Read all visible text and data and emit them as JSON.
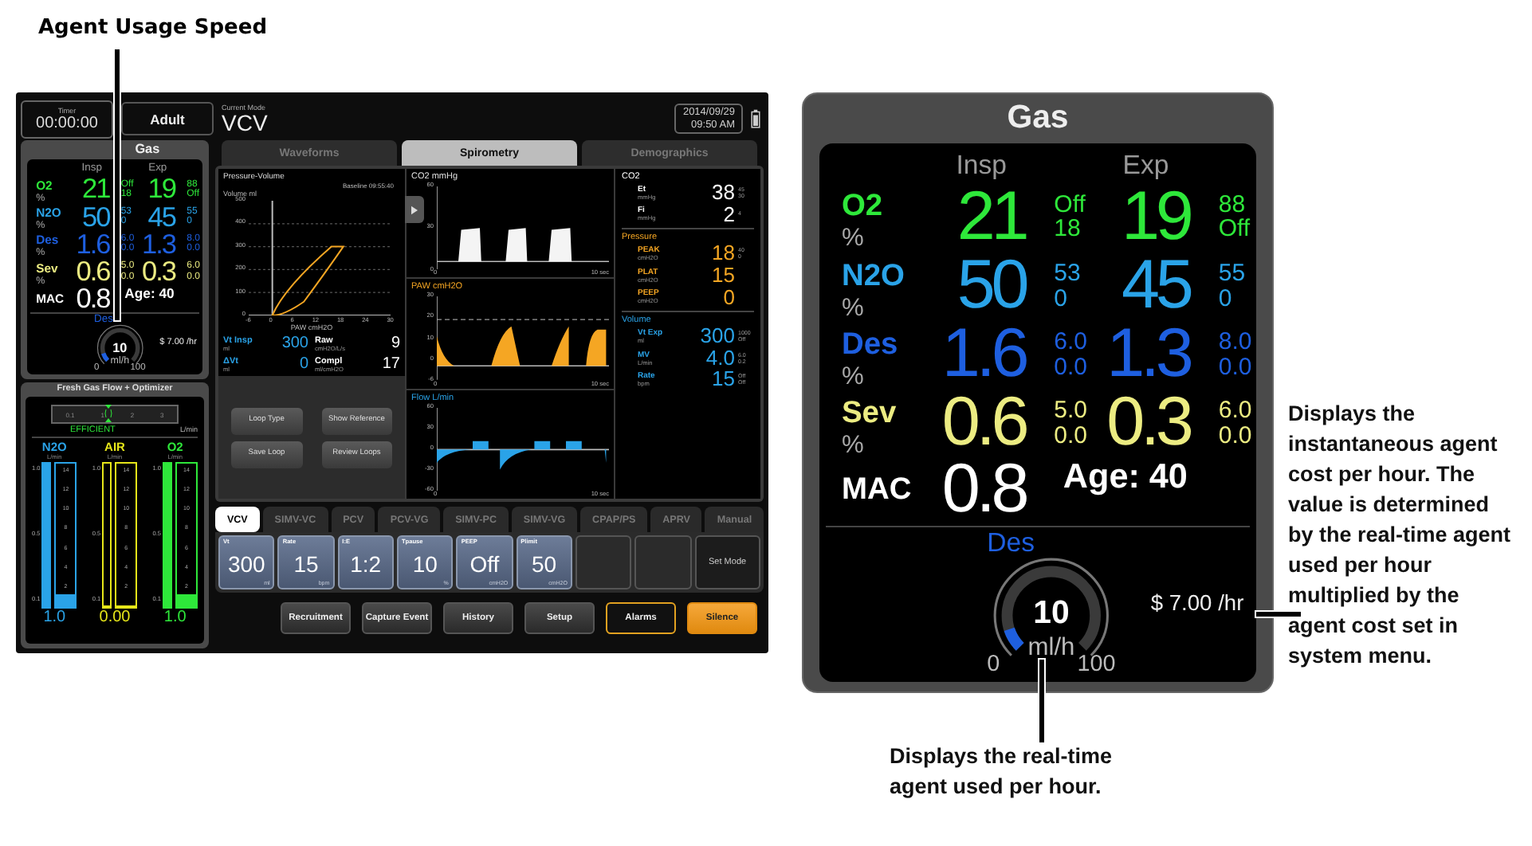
{
  "callouts": {
    "title": "Agent Usage Speed",
    "usage_note": "Displays the real-time agent used per hour.",
    "cost_note": "Displays the instantaneous agent cost per hour. The value is determined by the real-time agent used per hour multiplied by the agent cost set in system menu."
  },
  "screen": {
    "timer": {
      "label": "Timer",
      "value": "00:00:00"
    },
    "patient_type": "Adult",
    "mode": {
      "label": "Current Mode",
      "value": "VCV"
    },
    "date": "2014/09/29",
    "time": "09:50 AM",
    "gas": {
      "title": "Gas",
      "columns": [
        "Insp",
        "Exp"
      ],
      "agents": [
        {
          "name": "O2",
          "unit": "%",
          "color": "#2ee83a",
          "insp": "21",
          "insp_limits": [
            "Off",
            "18"
          ],
          "exp": "19",
          "exp_limits": [
            "88",
            "Off"
          ]
        },
        {
          "name": "N2O",
          "unit": "%",
          "color": "#2aa3e8",
          "insp": "50",
          "insp_limits": [
            "53",
            "0"
          ],
          "exp": "45",
          "exp_limits": [
            "55",
            "0"
          ]
        },
        {
          "name": "Des",
          "unit": "%",
          "color": "#1e5fe0",
          "insp": "1.6",
          "insp_limits": [
            "6.0",
            "0.0"
          ],
          "exp": "1.3",
          "exp_limits": [
            "8.0",
            "0.0"
          ]
        },
        {
          "name": "Sev",
          "unit": "%",
          "color": "#ecec82",
          "insp": "0.6",
          "insp_limits": [
            "5.0",
            "0.0"
          ],
          "exp": "0.3",
          "exp_limits": [
            "6.0",
            "0.0"
          ]
        }
      ],
      "mac": {
        "label": "MAC",
        "value": "0.8",
        "age": "Age: 40"
      },
      "usage": {
        "agent": "Des",
        "value": "10",
        "unit": "ml/h",
        "min": "0",
        "max": "100",
        "level": 0.1,
        "cost": "$ 7.00 /hr"
      }
    },
    "fresh_gas": {
      "title": "Fresh Gas Flow + Optimizer",
      "scale": [
        "0.1",
        "1",
        "2",
        "3"
      ],
      "level": 0.45,
      "status": "EFFICIENT",
      "unit": "L/min",
      "meters": [
        {
          "name": "N2O",
          "unit": "L/min",
          "color": "#2aa3e8",
          "fine_ticks": [
            "1.0",
            "0.5",
            "0.1"
          ],
          "coarse_ticks": [
            "14",
            "12",
            "10",
            "8",
            "6",
            "4",
            "2"
          ],
          "fine": {
            "level": 1
          },
          "coarse": {
            "level": 0.08
          },
          "value": "1.0"
        },
        {
          "name": "AIR",
          "unit": "L/min",
          "color": "#e6e619",
          "fine_ticks": [
            "1.0",
            "0.5",
            "0.1"
          ],
          "coarse_ticks": [
            "14",
            "12",
            "10",
            "8",
            "6",
            "4",
            "2"
          ],
          "fine": {
            "level": 0
          },
          "coarse": {
            "level": 0
          },
          "value": "0.00"
        },
        {
          "name": "O2",
          "unit": "L/min",
          "color": "#2ee83a",
          "fine_ticks": [
            "1.0",
            "0.5",
            "0.1"
          ],
          "coarse_ticks": [
            "14",
            "12",
            "10",
            "8",
            "6",
            "4",
            "2"
          ],
          "fine": {
            "level": 1
          },
          "coarse": {
            "level": 0.08
          },
          "value": "1.0"
        }
      ]
    },
    "tabs": [
      {
        "label": "Waveforms",
        "selected": false
      },
      {
        "label": "Spirometry",
        "selected": true
      },
      {
        "label": "Demographics",
        "selected": false
      }
    ],
    "loop": {
      "title": "Pressure-Volume",
      "baseline": "Baseline 09:55:40",
      "ylabel": "Volume ml",
      "yticks": [
        "500",
        "400",
        "300",
        "200",
        "100",
        "0"
      ],
      "xticks": [
        "-6",
        "0",
        "6",
        "12",
        "18",
        "24",
        "30"
      ],
      "xlabel": "PAW cmH2O"
    },
    "loop_values": [
      {
        "label": "Vt Insp",
        "unit": "ml",
        "value": "300",
        "color": "#2aa3e8"
      },
      {
        "label": "Raw",
        "unit": "cmH2O/L/s",
        "value": "9",
        "color": "#ffffff"
      },
      {
        "label": "ΔVt",
        "unit": "ml",
        "value": "0",
        "color": "#2aa3e8"
      },
      {
        "label": "Compl",
        "unit": "ml/cmH2O",
        "value": "17",
        "color": "#ffffff"
      }
    ],
    "loop_buttons": [
      "Loop Type",
      "Show Reference",
      "Save Loop",
      "Review Loops"
    ],
    "waveforms": [
      {
        "kind": "co2",
        "title": "CO2 mmHg",
        "yticks": [
          "60",
          "30",
          "0"
        ],
        "xticks": [
          "0",
          "10 sec"
        ]
      },
      {
        "kind": "paw",
        "title": "PAW cmH2O",
        "yticks": [
          "30",
          "20",
          "10",
          "0",
          "-6"
        ],
        "xticks": [
          "0",
          "10 sec"
        ]
      },
      {
        "kind": "flow",
        "title": "Flow L/min",
        "yticks": [
          "60",
          "30",
          "0",
          "-30",
          "-60"
        ],
        "xticks": [
          "0",
          "10 sec"
        ]
      }
    ],
    "numerics": [
      {
        "title": "CO2",
        "color": "#ffffff",
        "items": [
          {
            "label": "Et",
            "unit": "mmHg",
            "value": "38",
            "limits": [
              "45",
              "30"
            ]
          },
          {
            "label": "Fi",
            "unit": "mmHg",
            "value": "2",
            "limits": [
              "4"
            ]
          }
        ]
      },
      {
        "title": "Pressure",
        "color": "#f5a623",
        "items": [
          {
            "label": "PEAK",
            "unit": "cmH2O",
            "value": "18",
            "limits": [
              "40",
              "0"
            ]
          },
          {
            "label": "PLAT",
            "unit": "cmH2O",
            "value": "15"
          },
          {
            "label": "PEEP",
            "unit": "cmH2O",
            "value": "0"
          }
        ]
      },
      {
        "title": "Volume",
        "color": "#2aa3e8",
        "items": [
          {
            "label": "Vt Exp",
            "unit": "ml",
            "value": "300",
            "limits": [
              "1000",
              "Off"
            ]
          },
          {
            "label": "MV",
            "unit": "L/min",
            "value": "4.0",
            "limits": [
              "6.0",
              "0.2"
            ]
          },
          {
            "label": "Rate",
            "unit": "bpm",
            "value": "15",
            "limits": [
              "Off",
              "Off"
            ]
          }
        ]
      }
    ],
    "modes": [
      {
        "label": "VCV",
        "selected": true
      },
      {
        "label": "SIMV-VC",
        "selected": false
      },
      {
        "label": "PCV",
        "selected": false
      },
      {
        "label": "PCV-VG",
        "selected": false
      },
      {
        "label": "SIMV-PC",
        "selected": false
      },
      {
        "label": "SIMV-VG",
        "selected": false
      },
      {
        "label": "CPAP/PS",
        "selected": false
      },
      {
        "label": "APRV",
        "selected": false
      },
      {
        "label": "Manual",
        "selected": false
      }
    ],
    "settings": [
      {
        "kind": "setting",
        "label": "Vt",
        "value": "300",
        "unit": "ml"
      },
      {
        "kind": "setting",
        "label": "Rate",
        "value": "15",
        "unit": "bpm"
      },
      {
        "kind": "setting",
        "label": "I:E",
        "value": "1:2"
      },
      {
        "kind": "setting",
        "label": "Tpause",
        "value": "10",
        "unit": "%"
      },
      {
        "kind": "setting",
        "label": "PEEP",
        "value": "Off",
        "unit": "cmH2O"
      },
      {
        "kind": "setting",
        "label": "Plimit",
        "value": "50",
        "unit": "cmH2O"
      },
      {
        "kind": "empty"
      },
      {
        "kind": "empty"
      },
      {
        "kind": "button",
        "label": "Set Mode"
      }
    ],
    "actions": [
      {
        "label": "Recruitment",
        "kind": "normal"
      },
      {
        "label": "Capture Event",
        "kind": "normal"
      },
      {
        "label": "History",
        "kind": "normal"
      },
      {
        "label": "Setup",
        "kind": "normal"
      },
      {
        "label": "Alarms",
        "kind": "outlined"
      },
      {
        "label": "Silence",
        "kind": "alert"
      }
    ]
  },
  "gas_detail": {
    "title": "Gas",
    "columns": [
      "Insp",
      "Exp"
    ],
    "agents": [
      {
        "name": "O2",
        "unit": "%",
        "color": "#2ee83a",
        "insp": "21",
        "insp_limits": [
          "Off",
          "18"
        ],
        "exp": "19",
        "exp_limits": [
          "88",
          "Off"
        ]
      },
      {
        "name": "N2O",
        "unit": "%",
        "color": "#2aa3e8",
        "insp": "50",
        "insp_limits": [
          "53",
          "0"
        ],
        "exp": "45",
        "exp_limits": [
          "55",
          "0"
        ]
      },
      {
        "name": "Des",
        "unit": "%",
        "color": "#1e5fe0",
        "insp": "1.6",
        "insp_limits": [
          "6.0",
          "0.0"
        ],
        "exp": "1.3",
        "exp_limits": [
          "8.0",
          "0.0"
        ]
      },
      {
        "name": "Sev",
        "unit": "%",
        "color": "#ecec82",
        "insp": "0.6",
        "insp_limits": [
          "5.0",
          "0.0"
        ],
        "exp": "0.3",
        "exp_limits": [
          "6.0",
          "0.0"
        ]
      }
    ],
    "mac": {
      "label": "MAC",
      "value": "0.8",
      "age": "Age: 40"
    },
    "usage": {
      "agent": "Des",
      "value": "10",
      "unit": "ml/h",
      "min": "0",
      "max": "100",
      "level": 0.1,
      "cost": "$ 7.00 /hr"
    }
  }
}
